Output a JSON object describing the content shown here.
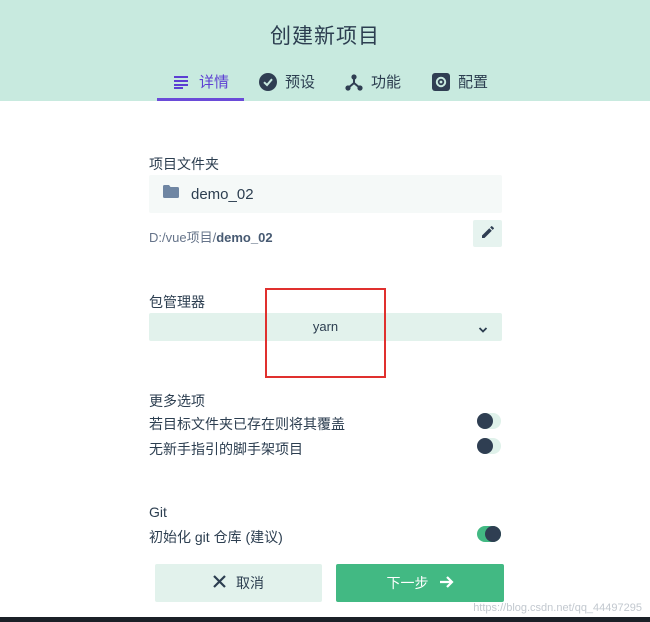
{
  "header": {
    "title": "创建新项目",
    "tabs": [
      {
        "label": "详情",
        "icon": "list-icon",
        "active": true
      },
      {
        "label": "预设",
        "icon": "check-circle-icon",
        "active": false
      },
      {
        "label": "功能",
        "icon": "branch-icon",
        "active": false
      },
      {
        "label": "配置",
        "icon": "settings-icon",
        "active": false
      }
    ]
  },
  "folder": {
    "label": "项目文件夹",
    "value": "demo_02",
    "path_prefix": "D:/vue项目/",
    "path_name": "demo_02"
  },
  "package_manager": {
    "label": "包管理器",
    "selected": "yarn"
  },
  "more_options": {
    "label": "更多选项",
    "items": [
      {
        "label": "若目标文件夹已存在则将其覆盖",
        "enabled": false
      },
      {
        "label": "无新手指引的脚手架项目",
        "enabled": false
      }
    ]
  },
  "git": {
    "label": "Git",
    "init_label": "初始化 git 仓库 (建议)",
    "enabled": true
  },
  "actions": {
    "cancel_label": "取消",
    "next_label": "下一步"
  },
  "watermark": "https://blog.csdn.net/qq_44497295",
  "colors": {
    "header_bg": "#c8eadf",
    "accent": "#42b983",
    "active_tab": "#5d3fd3",
    "highlight_box": "#e0302e"
  }
}
